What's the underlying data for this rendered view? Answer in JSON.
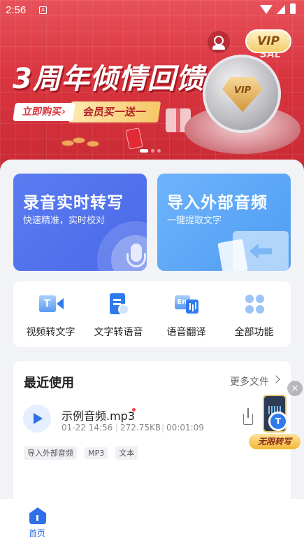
{
  "status_bar": {
    "time": "2:56",
    "sim_icon_text": "A",
    "icons": [
      "wifi-icon",
      "signal-icon",
      "battery-icon"
    ]
  },
  "banner": {
    "title": "3周年倾情回馈",
    "buy_label": "立即购买›",
    "member_label": "会员买一送一",
    "badge_text": "VIP",
    "sal_text": "SAL",
    "vip_button_label": "VIP",
    "page_dots": 3,
    "active_dot": 0,
    "colors": {
      "primary": "#d8343e",
      "gold": "#f4cd6b"
    }
  },
  "cards": {
    "record": {
      "title": "录音实时转写",
      "subtitle": "快速精准，实时校对",
      "icon": "microphone-icon",
      "color": "#4a6ae8"
    },
    "import": {
      "title": "导入外部音频",
      "subtitle": "一键提取文字",
      "icon": "folder-import-icon",
      "color": "#4e9cf3"
    }
  },
  "shortcuts": [
    {
      "label": "视频转文字",
      "icon": "video-to-text-icon",
      "glyph": "T"
    },
    {
      "label": "文字转语音",
      "icon": "text-to-speech-icon"
    },
    {
      "label": "语音翻译",
      "icon": "voice-translate-icon",
      "glyph": "En"
    },
    {
      "label": "全部功能",
      "icon": "all-features-icon"
    }
  ],
  "recent": {
    "title": "最近使用",
    "more_label": "更多文件",
    "file": {
      "name": "示例音频.mp3",
      "date": "01-22 14:56",
      "size": "272.75KB",
      "duration": "00:01:09",
      "tags": [
        "导入外部音频",
        "MP3",
        "文本"
      ]
    }
  },
  "float_promo": {
    "label": "无限转写",
    "close_glyph": "×",
    "disc_glyph": "T"
  },
  "bottom_nav": {
    "items": [
      {
        "label": "首页",
        "icon": "home-icon",
        "active": true
      }
    ],
    "accent": "#2f6fe8"
  }
}
